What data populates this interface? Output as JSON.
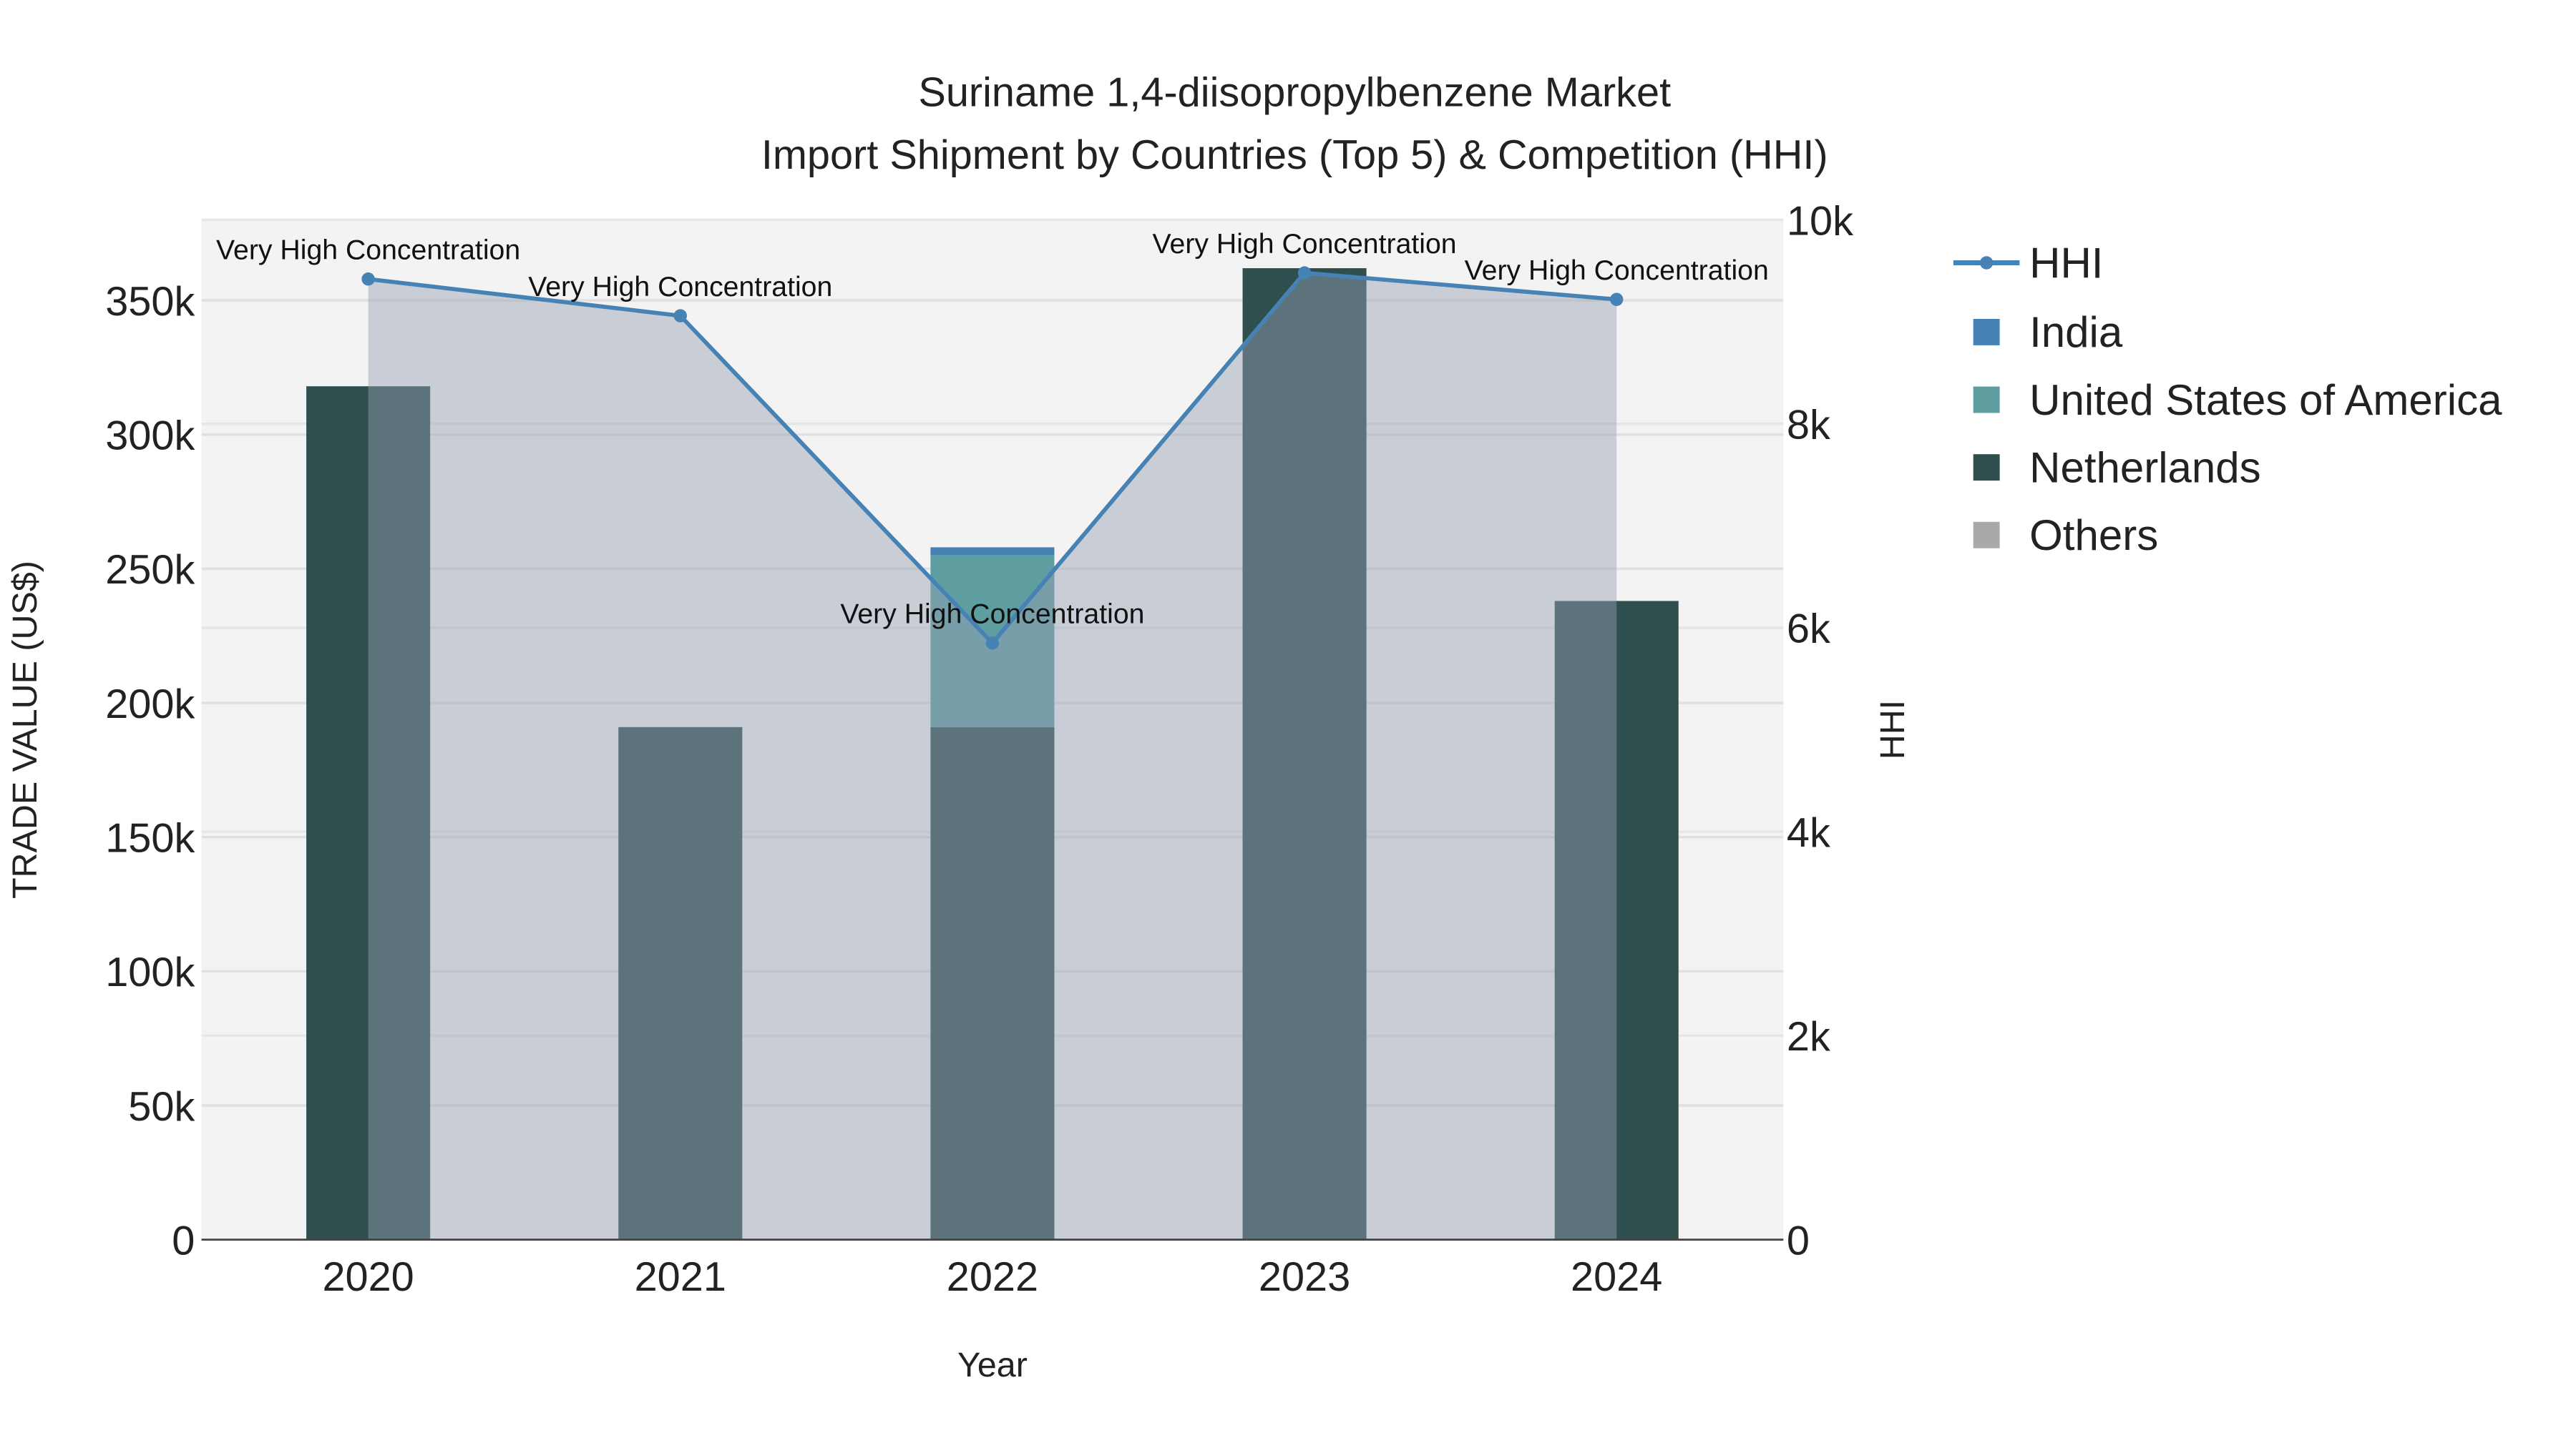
{
  "chart_data": {
    "type": "bar",
    "title": "Suriname 1,4-diisopropylbenzene Market",
    "subtitle": "Import Shipment by Countries (Top 5) & Competition (HHI)",
    "xlabel": "Year",
    "ylabel": "TRADE VALUE (US$)",
    "y2label": "HHI",
    "categories": [
      "2020",
      "2021",
      "2022",
      "2023",
      "2024"
    ],
    "ylim": [
      0,
      380000
    ],
    "y2lim": [
      0,
      10000
    ],
    "yticks": [
      0,
      50000,
      100000,
      150000,
      200000,
      250000,
      300000,
      350000
    ],
    "ytick_labels": [
      "0",
      "50k",
      "100k",
      "150k",
      "200k",
      "250k",
      "300k",
      "350k"
    ],
    "y2ticks": [
      0,
      2000,
      4000,
      6000,
      8000,
      10000
    ],
    "y2tick_labels": [
      "0",
      "2k",
      "4k",
      "6k",
      "8k",
      "10k"
    ],
    "barmode": "stack",
    "series": [
      {
        "name": "Netherlands",
        "color": "#2f4f4f",
        "values": [
          318000,
          191000,
          191000,
          362000,
          238000
        ]
      },
      {
        "name": "United States of America",
        "color": "#5f9ea0",
        "values": [
          0,
          0,
          64000,
          0,
          0
        ]
      },
      {
        "name": "India",
        "color": "#4682b4",
        "values": [
          0,
          0,
          3000,
          0,
          0
        ]
      },
      {
        "name": "Others",
        "color": "#a9a9a9",
        "values": [
          0,
          0,
          0,
          0,
          0
        ]
      }
    ],
    "hhi": {
      "name": "HHI",
      "color": "#4682b4",
      "values": [
        9420,
        9060,
        5850,
        9480,
        9220
      ],
      "annotations": [
        "Very High Concentration",
        "Very High Concentration",
        "Very High Concentration",
        "Very High Concentration",
        "Very High Concentration"
      ]
    },
    "legend": {
      "placement": "right",
      "items": [
        "HHI",
        "India",
        "United States of America",
        "Netherlands",
        "Others"
      ]
    },
    "grid": true
  }
}
